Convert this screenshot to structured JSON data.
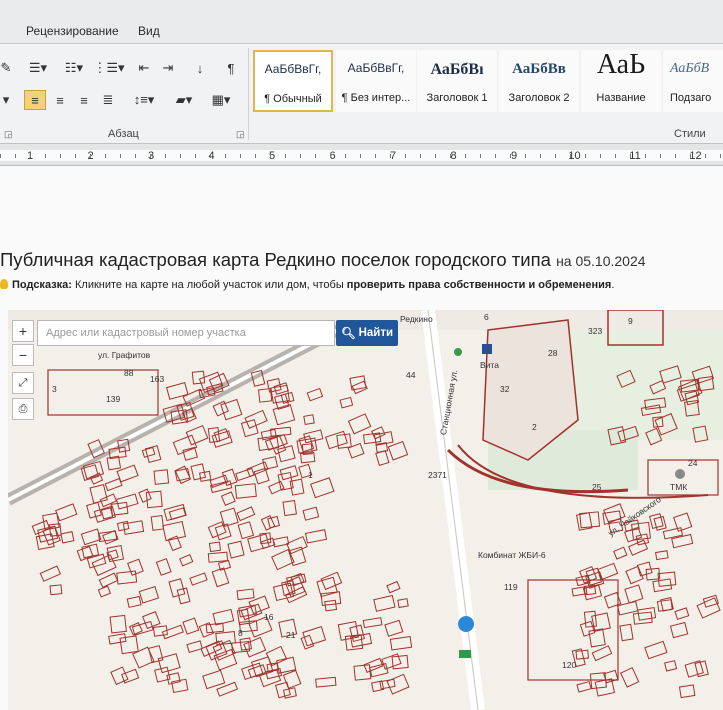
{
  "ribbon": {
    "tabs": [
      "Рецензирование",
      "Вид"
    ],
    "paragraph_group_label": "Абзац",
    "styles_group_label": "Стили",
    "styles": [
      {
        "preview": "АаБбВвГг,",
        "name": "¶ Обычный"
      },
      {
        "preview": "АаБбВвГг,",
        "name": "¶ Без интер..."
      },
      {
        "preview": "АаБбВı",
        "name": "Заголовок 1"
      },
      {
        "preview": "АаБбВв",
        "name": "Заголовок 2"
      },
      {
        "preview": "АаЬ",
        "name": "Название"
      },
      {
        "preview": "АаБбВ",
        "name": "Подзаго"
      }
    ],
    "pilcrow": "¶"
  },
  "ruler": {
    "numbers": [
      "1",
      "2",
      "3",
      "4",
      "5",
      "6",
      "7",
      "8",
      "9",
      "10",
      "11",
      "12"
    ]
  },
  "document": {
    "title": "Публичная кадастровая карта Редкино поселок городского типа",
    "title_date": "на 05.10.2024",
    "hint_label": "Подсказка:",
    "hint_text": "Кликните на карте на любой участок или дом, чтобы",
    "hint_bold": "проверить права собственности и обременения",
    "hint_end": "."
  },
  "map": {
    "search_placeholder": "Адрес или кадастровый номер участка",
    "search_button": "Найти",
    "zoom_in": "+",
    "zoom_out": "−",
    "labels": {
      "street_grafitov": "ул. Графитов",
      "station_street": "Станционная ул.",
      "chaikovskogo": "ул. Чайковского",
      "kombinat": "Комбинат ЖБИ-6",
      "vita": "Вита",
      "tmk": "ТМК",
      "redkino_top": "Редкино"
    },
    "parcel_numbers": [
      "6",
      "9",
      "323",
      "28",
      "88",
      "163",
      "139",
      "44",
      "2",
      "24",
      "25",
      "2371",
      "119",
      "120",
      "16",
      "21",
      "8",
      "3",
      "1",
      "32"
    ],
    "colors": {
      "parcel_stroke": "#a2322c",
      "road": "#ffffff",
      "accent_blue": "#20579a",
      "marker": "#2b88d8"
    }
  }
}
